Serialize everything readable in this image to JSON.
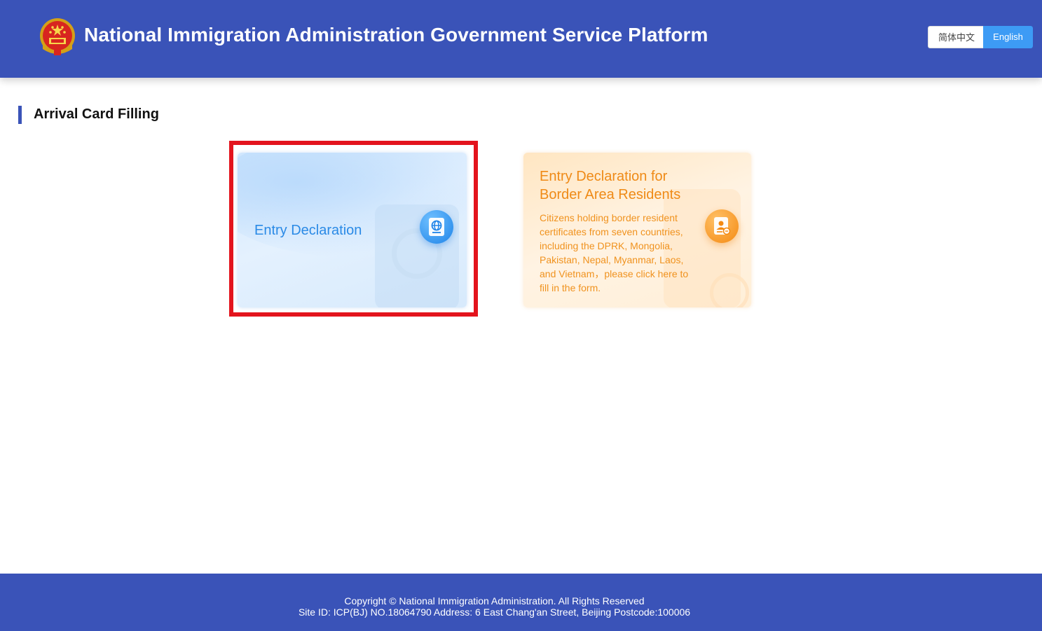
{
  "header": {
    "title": "National Immigration Administration Government Service Platform",
    "language": {
      "zh_label": "简体中文",
      "en_label": "English",
      "active": "English"
    }
  },
  "section": {
    "title": "Arrival Card Filling"
  },
  "cards": [
    {
      "title": "Entry Declaration",
      "icon": "passport-globe-icon",
      "highlighted": true
    },
    {
      "title": "Entry Declaration for Border Area Residents",
      "description": "Citizens holding border resident certificates from seven countries, including the DPRK, Mongolia, Pakistan, Nepal, Myanmar, Laos, and Vietnam，please click here to fill in the form.",
      "icon": "resident-id-card-icon"
    }
  ],
  "footer": {
    "copyright": "Copyright © National Immigration Administration. All Rights Reserved",
    "site_info": "Site ID: ICP(BJ) NO.18064790 Address: 6 East Chang'an Street, Beijing Postcode:100006"
  },
  "colors": {
    "brand": "#3a53b8",
    "accent_blue": "#3d9bf5",
    "highlight_red": "#e3141d",
    "card_orange_text": "#ef8a16"
  }
}
